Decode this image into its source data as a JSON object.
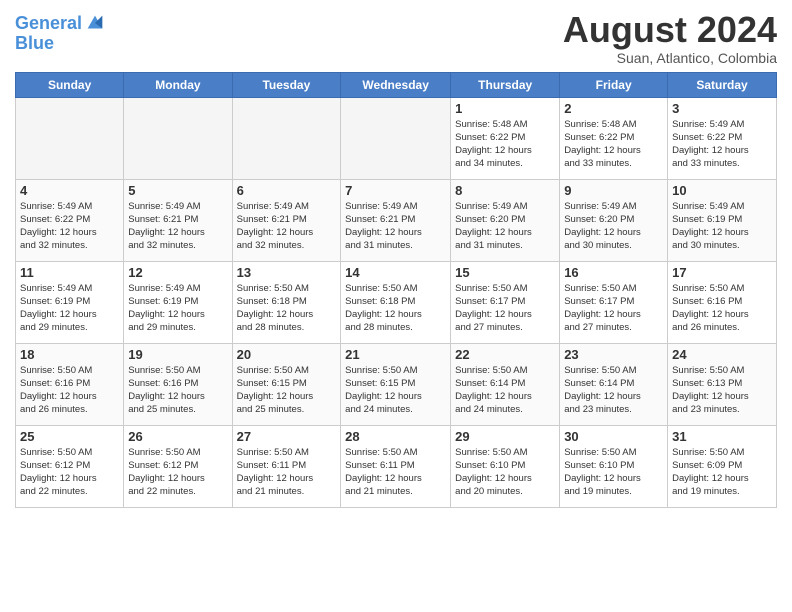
{
  "header": {
    "logo_line1": "General",
    "logo_line2": "Blue",
    "month_year": "August 2024",
    "location": "Suan, Atlantico, Colombia"
  },
  "weekdays": [
    "Sunday",
    "Monday",
    "Tuesday",
    "Wednesday",
    "Thursday",
    "Friday",
    "Saturday"
  ],
  "weeks": [
    [
      {
        "day": "",
        "info": ""
      },
      {
        "day": "",
        "info": ""
      },
      {
        "day": "",
        "info": ""
      },
      {
        "day": "",
        "info": ""
      },
      {
        "day": "1",
        "info": "Sunrise: 5:48 AM\nSunset: 6:22 PM\nDaylight: 12 hours\nand 34 minutes."
      },
      {
        "day": "2",
        "info": "Sunrise: 5:48 AM\nSunset: 6:22 PM\nDaylight: 12 hours\nand 33 minutes."
      },
      {
        "day": "3",
        "info": "Sunrise: 5:49 AM\nSunset: 6:22 PM\nDaylight: 12 hours\nand 33 minutes."
      }
    ],
    [
      {
        "day": "4",
        "info": "Sunrise: 5:49 AM\nSunset: 6:22 PM\nDaylight: 12 hours\nand 32 minutes."
      },
      {
        "day": "5",
        "info": "Sunrise: 5:49 AM\nSunset: 6:21 PM\nDaylight: 12 hours\nand 32 minutes."
      },
      {
        "day": "6",
        "info": "Sunrise: 5:49 AM\nSunset: 6:21 PM\nDaylight: 12 hours\nand 32 minutes."
      },
      {
        "day": "7",
        "info": "Sunrise: 5:49 AM\nSunset: 6:21 PM\nDaylight: 12 hours\nand 31 minutes."
      },
      {
        "day": "8",
        "info": "Sunrise: 5:49 AM\nSunset: 6:20 PM\nDaylight: 12 hours\nand 31 minutes."
      },
      {
        "day": "9",
        "info": "Sunrise: 5:49 AM\nSunset: 6:20 PM\nDaylight: 12 hours\nand 30 minutes."
      },
      {
        "day": "10",
        "info": "Sunrise: 5:49 AM\nSunset: 6:19 PM\nDaylight: 12 hours\nand 30 minutes."
      }
    ],
    [
      {
        "day": "11",
        "info": "Sunrise: 5:49 AM\nSunset: 6:19 PM\nDaylight: 12 hours\nand 29 minutes."
      },
      {
        "day": "12",
        "info": "Sunrise: 5:49 AM\nSunset: 6:19 PM\nDaylight: 12 hours\nand 29 minutes."
      },
      {
        "day": "13",
        "info": "Sunrise: 5:50 AM\nSunset: 6:18 PM\nDaylight: 12 hours\nand 28 minutes."
      },
      {
        "day": "14",
        "info": "Sunrise: 5:50 AM\nSunset: 6:18 PM\nDaylight: 12 hours\nand 28 minutes."
      },
      {
        "day": "15",
        "info": "Sunrise: 5:50 AM\nSunset: 6:17 PM\nDaylight: 12 hours\nand 27 minutes."
      },
      {
        "day": "16",
        "info": "Sunrise: 5:50 AM\nSunset: 6:17 PM\nDaylight: 12 hours\nand 27 minutes."
      },
      {
        "day": "17",
        "info": "Sunrise: 5:50 AM\nSunset: 6:16 PM\nDaylight: 12 hours\nand 26 minutes."
      }
    ],
    [
      {
        "day": "18",
        "info": "Sunrise: 5:50 AM\nSunset: 6:16 PM\nDaylight: 12 hours\nand 26 minutes."
      },
      {
        "day": "19",
        "info": "Sunrise: 5:50 AM\nSunset: 6:16 PM\nDaylight: 12 hours\nand 25 minutes."
      },
      {
        "day": "20",
        "info": "Sunrise: 5:50 AM\nSunset: 6:15 PM\nDaylight: 12 hours\nand 25 minutes."
      },
      {
        "day": "21",
        "info": "Sunrise: 5:50 AM\nSunset: 6:15 PM\nDaylight: 12 hours\nand 24 minutes."
      },
      {
        "day": "22",
        "info": "Sunrise: 5:50 AM\nSunset: 6:14 PM\nDaylight: 12 hours\nand 24 minutes."
      },
      {
        "day": "23",
        "info": "Sunrise: 5:50 AM\nSunset: 6:14 PM\nDaylight: 12 hours\nand 23 minutes."
      },
      {
        "day": "24",
        "info": "Sunrise: 5:50 AM\nSunset: 6:13 PM\nDaylight: 12 hours\nand 23 minutes."
      }
    ],
    [
      {
        "day": "25",
        "info": "Sunrise: 5:50 AM\nSunset: 6:12 PM\nDaylight: 12 hours\nand 22 minutes."
      },
      {
        "day": "26",
        "info": "Sunrise: 5:50 AM\nSunset: 6:12 PM\nDaylight: 12 hours\nand 22 minutes."
      },
      {
        "day": "27",
        "info": "Sunrise: 5:50 AM\nSunset: 6:11 PM\nDaylight: 12 hours\nand 21 minutes."
      },
      {
        "day": "28",
        "info": "Sunrise: 5:50 AM\nSunset: 6:11 PM\nDaylight: 12 hours\nand 21 minutes."
      },
      {
        "day": "29",
        "info": "Sunrise: 5:50 AM\nSunset: 6:10 PM\nDaylight: 12 hours\nand 20 minutes."
      },
      {
        "day": "30",
        "info": "Sunrise: 5:50 AM\nSunset: 6:10 PM\nDaylight: 12 hours\nand 19 minutes."
      },
      {
        "day": "31",
        "info": "Sunrise: 5:50 AM\nSunset: 6:09 PM\nDaylight: 12 hours\nand 19 minutes."
      }
    ]
  ]
}
